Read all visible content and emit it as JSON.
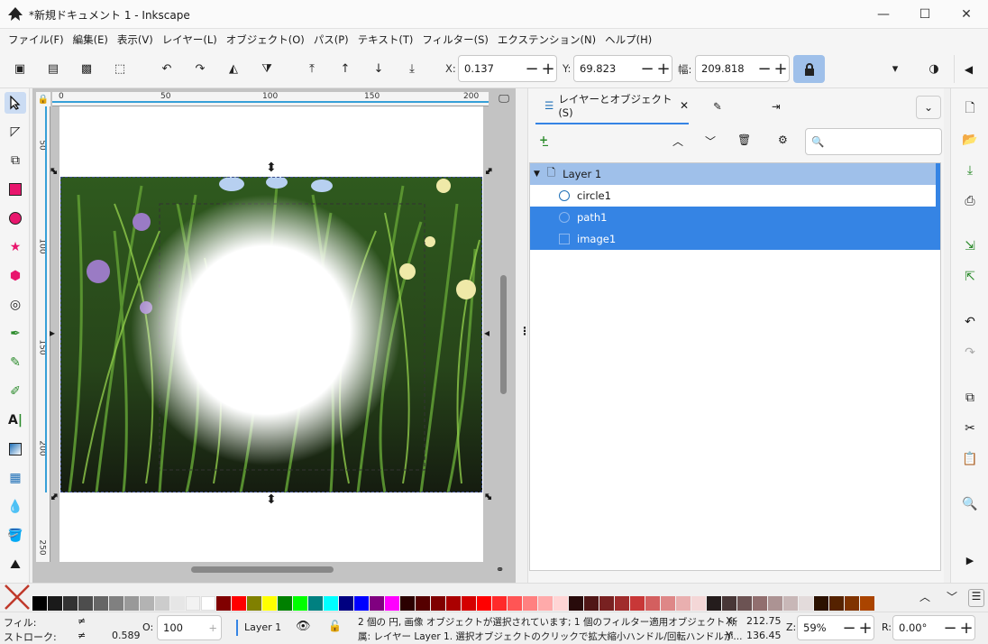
{
  "window": {
    "title": "*新規ドキュメント 1 - Inkscape"
  },
  "menu": [
    "ファイル(F)",
    "編集(E)",
    "表示(V)",
    "レイヤー(L)",
    "オブジェクト(O)",
    "パス(P)",
    "テキスト(T)",
    "フィルター(S)",
    "エクステンション(N)",
    "ヘルプ(H)"
  ],
  "toolbar": {
    "x_label": "X:",
    "x_value": "0.137",
    "y_label": "Y:",
    "y_value": "69.823",
    "w_label": "幅:",
    "w_value": "209.818"
  },
  "ruler": {
    "h_labels": [
      "0",
      "50",
      "100",
      "150",
      "200"
    ],
    "v_labels": [
      "50",
      "100",
      "150",
      "200",
      "250"
    ]
  },
  "panel": {
    "tab_label": "レイヤーとオブジェクト(S)",
    "layer_name": "Layer 1",
    "objects": [
      "circle1",
      "path1",
      "image1"
    ]
  },
  "status": {
    "fill_label": "フィル:",
    "fill_value": "≠",
    "stroke_label": "ストローク:",
    "stroke_value": "≠",
    "stroke_width": "0.589",
    "opacity_label": "O:",
    "opacity_value": "100",
    "layer_indicator": "Layer 1",
    "message_line1": "2 個の 円, 画像 オブジェクトが選択されています; 1 個のフィルター適用オブジェクト 所",
    "message_line2": "属: レイヤー Layer 1. 選択オブジェクトのクリックで拡大縮小ハンドル/回転ハンドルが...",
    "x_label": "X:",
    "x_value": "212.75",
    "y_label": "Y:",
    "y_value": "136.45",
    "zoom_label": "Z:",
    "zoom_value": "59%",
    "rotate_label": "R:",
    "rotate_value": "0.00°"
  },
  "palette_colors": [
    "#000000",
    "#1a1a1a",
    "#333333",
    "#4d4d4d",
    "#666666",
    "#808080",
    "#999999",
    "#b3b3b3",
    "#cccccc",
    "#e6e6e6",
    "#f2f2f2",
    "#ffffff",
    "#800000",
    "#ff0000",
    "#808000",
    "#ffff00",
    "#008000",
    "#00ff00",
    "#008080",
    "#00ffff",
    "#000080",
    "#0000ff",
    "#800080",
    "#ff00ff",
    "#2b0000",
    "#550000",
    "#800000",
    "#aa0000",
    "#d40000",
    "#ff0000",
    "#ff2a2a",
    "#ff5555",
    "#ff8080",
    "#ffaaaa",
    "#ffd5d5",
    "#280b0b",
    "#501616",
    "#782121",
    "#a02c2c",
    "#c83737",
    "#d35f5f",
    "#de8787",
    "#e9afaf",
    "#f4d7d7",
    "#241c1c",
    "#483737",
    "#6c5353",
    "#916f6f",
    "#ac9393",
    "#c8b7b7",
    "#e3dbdb",
    "#2b1100",
    "#552200",
    "#803300",
    "#aa4400"
  ],
  "accent": "#3584e4"
}
